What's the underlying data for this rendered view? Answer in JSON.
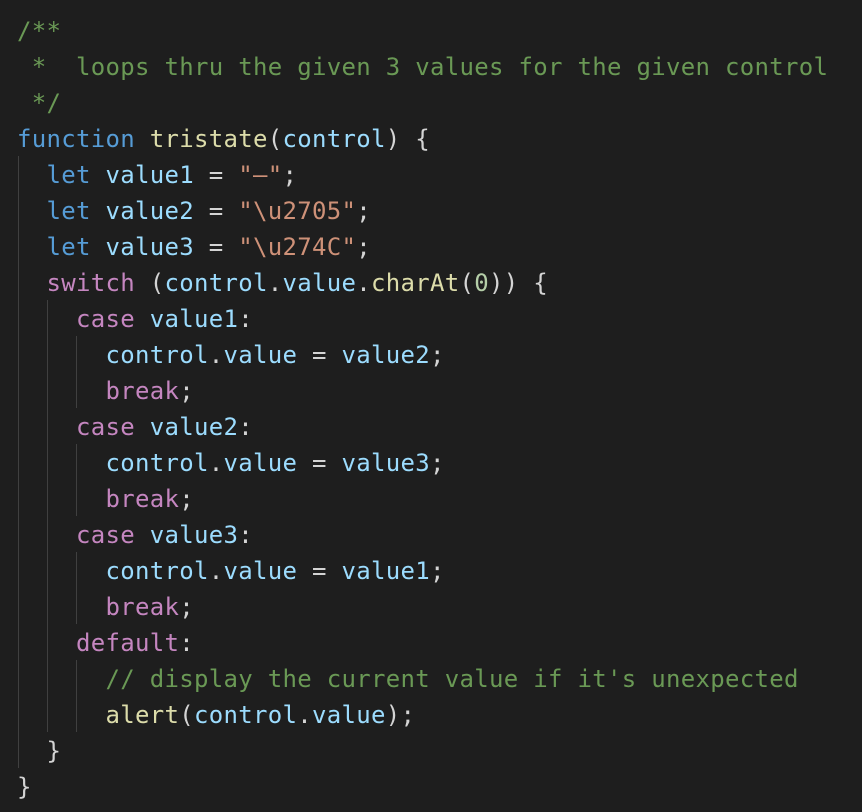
{
  "editor": {
    "theme_colors": {
      "background": "#1e1e1e",
      "comment": "#6a9955",
      "keyword": "#569cd6",
      "control_keyword": "#c586c0",
      "function": "#dcdcaa",
      "variable": "#9cdcfe",
      "string": "#ce9178",
      "number": "#b5cea8",
      "punctuation": "#d4d4d4"
    },
    "lines": [
      {
        "tokens": [
          {
            "t": "/**",
            "c": "comment"
          }
        ]
      },
      {
        "tokens": [
          {
            "t": " *  loops thru the given 3 values for the given control",
            "c": "comment"
          }
        ]
      },
      {
        "tokens": [
          {
            "t": " */",
            "c": "comment"
          }
        ]
      },
      {
        "tokens": [
          {
            "t": "function",
            "c": "kw"
          },
          {
            "t": " ",
            "c": "punc"
          },
          {
            "t": "tristate",
            "c": "fn"
          },
          {
            "t": "(",
            "c": "punc"
          },
          {
            "t": "control",
            "c": "var"
          },
          {
            "t": ") {",
            "c": "punc"
          }
        ]
      },
      {
        "tokens": [
          {
            "t": "  ",
            "c": "punc"
          },
          {
            "t": "let",
            "c": "kw"
          },
          {
            "t": " ",
            "c": "punc"
          },
          {
            "t": "value1",
            "c": "var"
          },
          {
            "t": " = ",
            "c": "punc"
          },
          {
            "t": "\"–\"",
            "c": "str"
          },
          {
            "t": ";",
            "c": "punc"
          }
        ]
      },
      {
        "tokens": [
          {
            "t": "  ",
            "c": "punc"
          },
          {
            "t": "let",
            "c": "kw"
          },
          {
            "t": " ",
            "c": "punc"
          },
          {
            "t": "value2",
            "c": "var"
          },
          {
            "t": " = ",
            "c": "punc"
          },
          {
            "t": "\"\\u2705\"",
            "c": "str"
          },
          {
            "t": ";",
            "c": "punc"
          }
        ]
      },
      {
        "tokens": [
          {
            "t": "  ",
            "c": "punc"
          },
          {
            "t": "let",
            "c": "kw"
          },
          {
            "t": " ",
            "c": "punc"
          },
          {
            "t": "value3",
            "c": "var"
          },
          {
            "t": " = ",
            "c": "punc"
          },
          {
            "t": "\"\\u274C\"",
            "c": "str"
          },
          {
            "t": ";",
            "c": "punc"
          }
        ]
      },
      {
        "tokens": [
          {
            "t": "  ",
            "c": "punc"
          },
          {
            "t": "switch",
            "c": "ctrl"
          },
          {
            "t": " (",
            "c": "punc"
          },
          {
            "t": "control",
            "c": "var"
          },
          {
            "t": ".",
            "c": "punc"
          },
          {
            "t": "value",
            "c": "var"
          },
          {
            "t": ".",
            "c": "punc"
          },
          {
            "t": "charAt",
            "c": "fn"
          },
          {
            "t": "(",
            "c": "punc"
          },
          {
            "t": "0",
            "c": "num"
          },
          {
            "t": ")) {",
            "c": "punc"
          }
        ]
      },
      {
        "tokens": [
          {
            "t": "    ",
            "c": "punc"
          },
          {
            "t": "case",
            "c": "ctrl"
          },
          {
            "t": " ",
            "c": "punc"
          },
          {
            "t": "value1",
            "c": "var"
          },
          {
            "t": ":",
            "c": "punc"
          }
        ]
      },
      {
        "tokens": [
          {
            "t": "      ",
            "c": "punc"
          },
          {
            "t": "control",
            "c": "var"
          },
          {
            "t": ".",
            "c": "punc"
          },
          {
            "t": "value",
            "c": "var"
          },
          {
            "t": " = ",
            "c": "punc"
          },
          {
            "t": "value2",
            "c": "var"
          },
          {
            "t": ";",
            "c": "punc"
          }
        ]
      },
      {
        "tokens": [
          {
            "t": "      ",
            "c": "punc"
          },
          {
            "t": "break",
            "c": "ctrl"
          },
          {
            "t": ";",
            "c": "punc"
          }
        ]
      },
      {
        "tokens": [
          {
            "t": "    ",
            "c": "punc"
          },
          {
            "t": "case",
            "c": "ctrl"
          },
          {
            "t": " ",
            "c": "punc"
          },
          {
            "t": "value2",
            "c": "var"
          },
          {
            "t": ":",
            "c": "punc"
          }
        ]
      },
      {
        "tokens": [
          {
            "t": "      ",
            "c": "punc"
          },
          {
            "t": "control",
            "c": "var"
          },
          {
            "t": ".",
            "c": "punc"
          },
          {
            "t": "value",
            "c": "var"
          },
          {
            "t": " = ",
            "c": "punc"
          },
          {
            "t": "value3",
            "c": "var"
          },
          {
            "t": ";",
            "c": "punc"
          }
        ]
      },
      {
        "tokens": [
          {
            "t": "      ",
            "c": "punc"
          },
          {
            "t": "break",
            "c": "ctrl"
          },
          {
            "t": ";",
            "c": "punc"
          }
        ]
      },
      {
        "tokens": [
          {
            "t": "    ",
            "c": "punc"
          },
          {
            "t": "case",
            "c": "ctrl"
          },
          {
            "t": " ",
            "c": "punc"
          },
          {
            "t": "value3",
            "c": "var"
          },
          {
            "t": ":",
            "c": "punc"
          }
        ]
      },
      {
        "tokens": [
          {
            "t": "      ",
            "c": "punc"
          },
          {
            "t": "control",
            "c": "var"
          },
          {
            "t": ".",
            "c": "punc"
          },
          {
            "t": "value",
            "c": "var"
          },
          {
            "t": " = ",
            "c": "punc"
          },
          {
            "t": "value1",
            "c": "var"
          },
          {
            "t": ";",
            "c": "punc"
          }
        ]
      },
      {
        "tokens": [
          {
            "t": "      ",
            "c": "punc"
          },
          {
            "t": "break",
            "c": "ctrl"
          },
          {
            "t": ";",
            "c": "punc"
          }
        ]
      },
      {
        "tokens": [
          {
            "t": "    ",
            "c": "punc"
          },
          {
            "t": "default",
            "c": "ctrl"
          },
          {
            "t": ":",
            "c": "punc"
          }
        ]
      },
      {
        "tokens": [
          {
            "t": "      ",
            "c": "punc"
          },
          {
            "t": "// display the current value if it's unexpected",
            "c": "comment"
          }
        ]
      },
      {
        "tokens": [
          {
            "t": "      ",
            "c": "punc"
          },
          {
            "t": "alert",
            "c": "fn"
          },
          {
            "t": "(",
            "c": "punc"
          },
          {
            "t": "control",
            "c": "var"
          },
          {
            "t": ".",
            "c": "punc"
          },
          {
            "t": "value",
            "c": "var"
          },
          {
            "t": ");",
            "c": "punc"
          }
        ]
      },
      {
        "tokens": [
          {
            "t": "  }",
            "c": "punc"
          }
        ]
      },
      {
        "tokens": [
          {
            "t": "}",
            "c": "punc"
          }
        ]
      }
    ]
  }
}
